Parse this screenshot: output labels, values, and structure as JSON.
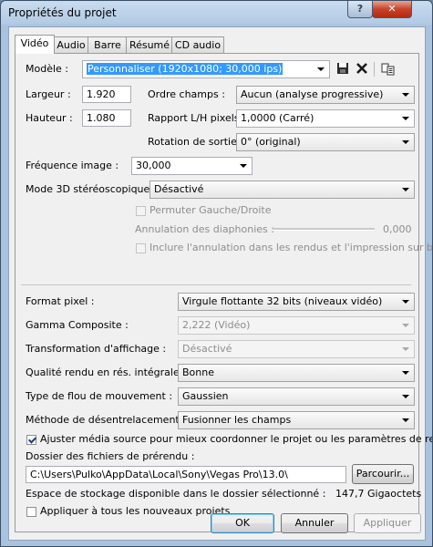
{
  "window": {
    "title": "Propriétés du projet",
    "help_glyph": "?",
    "close_glyph": "✕"
  },
  "tabs": [
    "Vidéo",
    "Audio",
    "Barre",
    "Résumé",
    "CD audio"
  ],
  "video": {
    "modele_label": "Modèle :",
    "modele_value": "Personnaliser (1920x1080; 30,000 ips)",
    "largeur_label": "Largeur :",
    "largeur_value": "1.920",
    "hauteur_label": "Hauteur :",
    "hauteur_value": "1.080",
    "ordre_label": "Ordre champs :",
    "ordre_value": "Aucun (analyse progressive)",
    "rapport_label": "Rapport L/H pixels :",
    "rapport_value": "1,0000 (Carré)",
    "rotation_label": "Rotation de sortie :",
    "rotation_value": "0° (original)",
    "freq_label": "Fréquence image :",
    "freq_value": "30,000",
    "mode3d_label": "Mode 3D stéréoscopique :",
    "mode3d_value": "Désactivé",
    "permuter_label": "Permuter Gauche/Droite",
    "annulation_label": "Annulation des diaphonies :",
    "annulation_value": "0,000",
    "inclure_label": "Inclure l'annulation dans les rendus et l'impression sur bande",
    "format_label": "Format pixel :",
    "format_value": "Virgule flottante 32 bits (niveaux vidéo)",
    "gamma_label": "Gamma Composite :",
    "gamma_value": "2,222 (Vidéo)",
    "transfo_label": "Transformation d'affichage :",
    "transfo_value": "Désactivé",
    "qualite_label": "Qualité rendu en rés. intégrale :",
    "qualite_value": "Bonne",
    "flou_label": "Type de flou de mouvement :",
    "flou_value": "Gaussien",
    "desentre_label": "Méthode de désentrelacement :",
    "desentre_value": "Fusionner les champs",
    "ajuster_label": "Ajuster média source pour mieux coordonner le projet ou les paramètres de rendu",
    "ajuster_checked": true,
    "dossier_label": "Dossier des fichiers de prérendu :",
    "dossier_value": "C:\\Users\\Pulko\\AppData\\Local\\Sony\\Vegas Pro\\13.0\\",
    "parcourir_label": "Parcourir...",
    "espace_label": "Espace de stockage disponible dans le dossier sélectionné :",
    "espace_value": "147,7 Gigaoctets",
    "appliquer_tous_label": "Appliquer à tous les nouveaux projets",
    "appliquer_tous_checked": false
  },
  "buttons": {
    "ok": "OK",
    "annuler": "Annuler",
    "appliquer": "Appliquer"
  },
  "icons": [
    "save-icon",
    "delete-icon",
    "copy-properties-icon"
  ]
}
